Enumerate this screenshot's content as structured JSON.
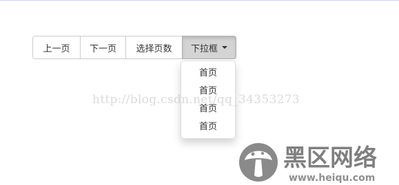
{
  "pagination": {
    "prev_label": "上一页",
    "next_label": "下一页",
    "select_label": "选择页数",
    "dropdown_label": "下拉框"
  },
  "dropdown": {
    "items": [
      "首页",
      "首页",
      "首页",
      "首页"
    ]
  },
  "watermark": {
    "url": "http://blog.csdn.net/qq_34353273",
    "logo_text": "黑区网络",
    "logo_domain": "www.heiqu.com"
  },
  "icons": {
    "caret": "caret-down-icon",
    "logo": "mushroom-logo-icon"
  }
}
